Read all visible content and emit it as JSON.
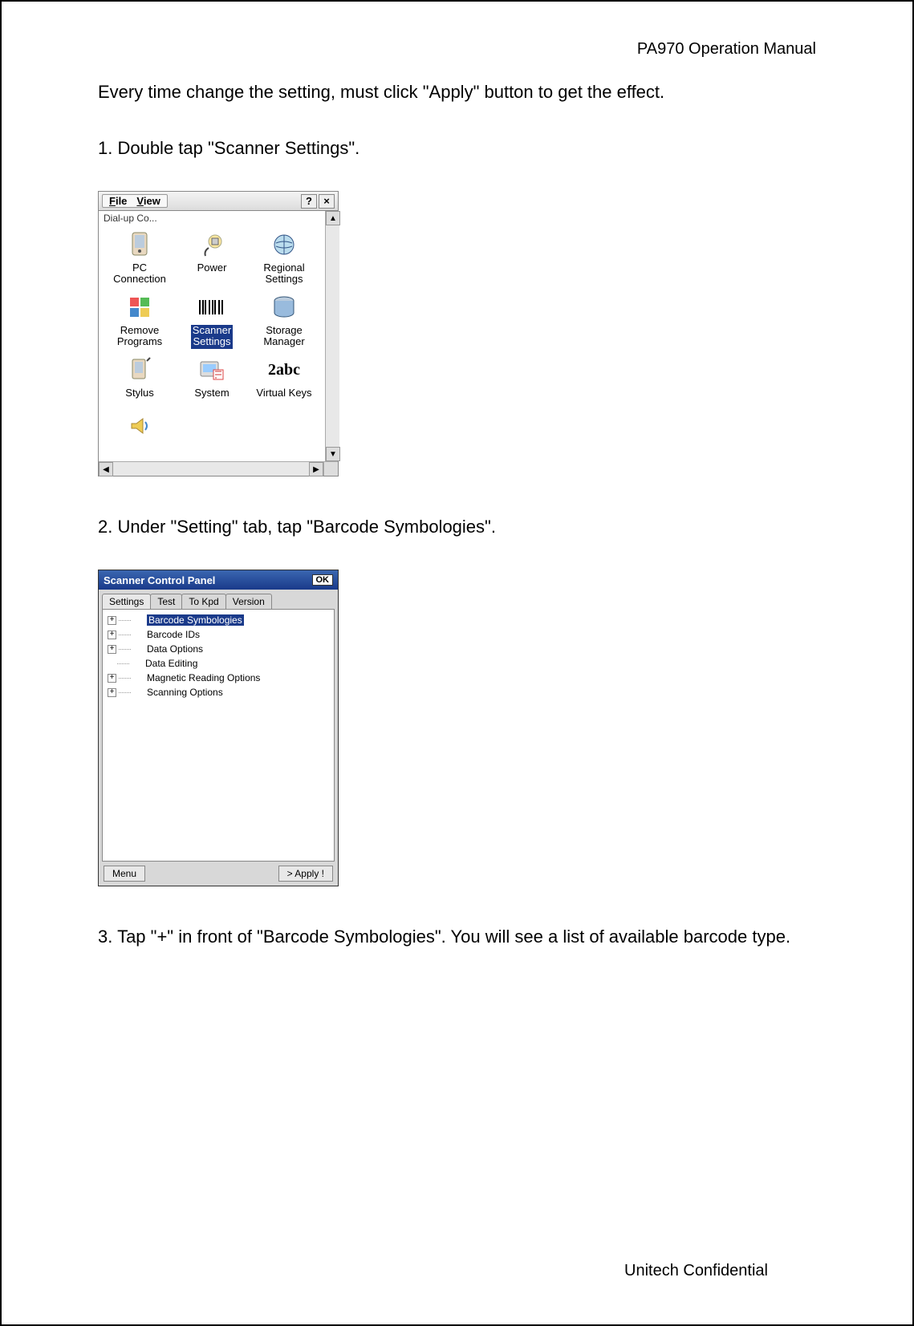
{
  "document": {
    "header": "PA970 Operation Manual",
    "intro": "Every time change the setting, must click \"Apply\" button to get the effect.",
    "step1": "1. Double tap \"Scanner Settings\".",
    "step2": "2. Under \"Setting\" tab, tap \"Barcode Symbologies\".",
    "step3": "3. Tap \"+\" in front of \"Barcode Symbologies\". You will see a list of available barcode type.",
    "footer": "Unitech Confidential"
  },
  "screenshot1": {
    "menu": {
      "file": "File",
      "view": "View"
    },
    "help": "?",
    "close": "×",
    "topcut": "Dial-up Co...",
    "icons": {
      "r1c1": "PC\nConnection",
      "r1c2": "Power",
      "r1c3": "Regional\nSettings",
      "r2c1": "Remove\nPrograms",
      "r2c2": "Scanner\nSettings",
      "r2c3": "Storage\nManager",
      "r3c1": "Stylus",
      "r3c2": "System",
      "r3c3": "Virtual Keys"
    },
    "scroll": {
      "up": "▲",
      "down": "▼",
      "left": "◀",
      "right": "▶"
    }
  },
  "screenshot2": {
    "title": "Scanner Control Panel",
    "ok": "OK",
    "tabs": {
      "settings": "Settings",
      "test": "Test",
      "tokpd": "To Kpd",
      "version": "Version"
    },
    "tree": {
      "n1": "Barcode Symbologies",
      "n2": "Barcode IDs",
      "n3": "Data Options",
      "n4": "Data Editing",
      "n5": "Magnetic Reading Options",
      "n6": "Scanning Options",
      "plus": "+"
    },
    "menu_btn": "Menu",
    "apply_btn": "> Apply !"
  }
}
